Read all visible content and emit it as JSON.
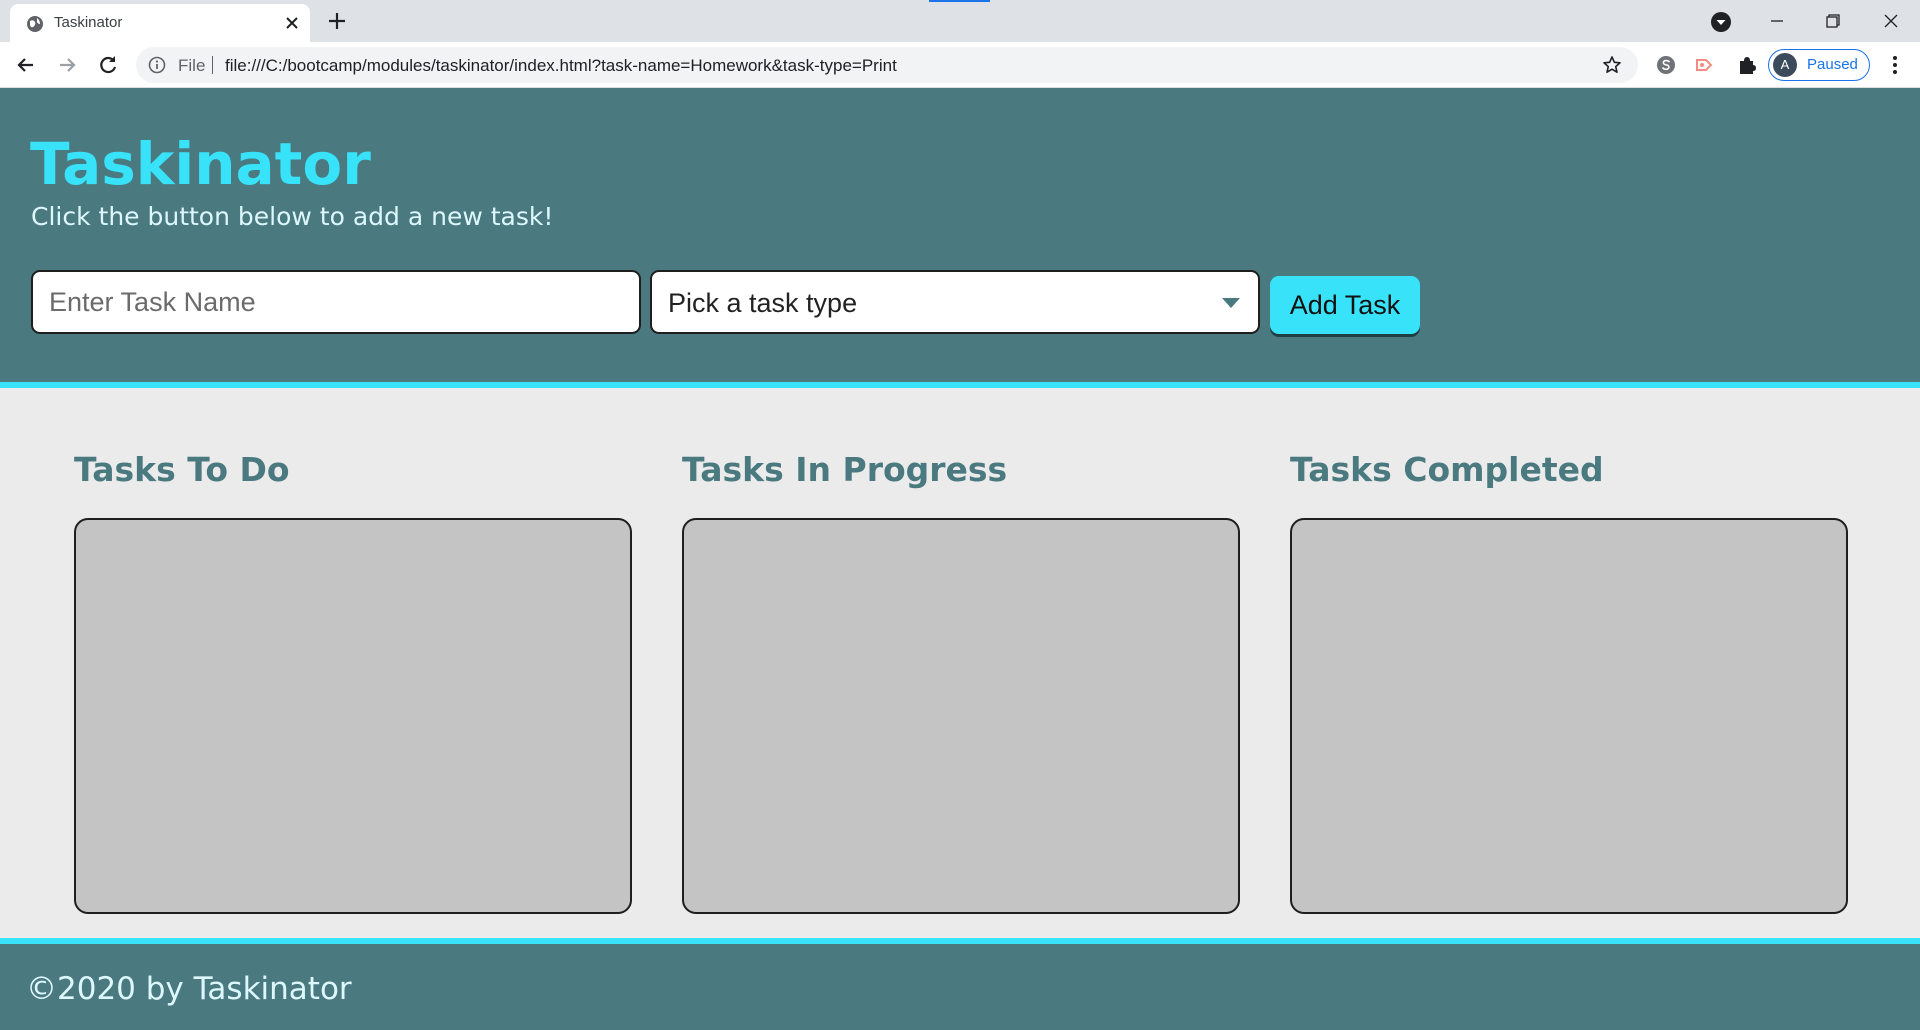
{
  "browser": {
    "tab_title": "Taskinator",
    "omnibox": {
      "file_label": "File",
      "url": "file:///C:/bootcamp/modules/taskinator/index.html?task-name=Homework&task-type=Print"
    },
    "profile": {
      "initial": "A",
      "status": "Paused"
    },
    "icons": [
      "globe-icon",
      "close-icon",
      "plus-icon",
      "back-icon",
      "forward-icon",
      "reload-icon",
      "info-icon",
      "star-icon",
      "skype-icon",
      "cast-icon",
      "puzzle-icon",
      "kebab-menu-icon",
      "minimize-icon",
      "restore-icon"
    ]
  },
  "header": {
    "title": "Taskinator",
    "subtitle": "Click the button below to add a new task!"
  },
  "form": {
    "task_name_placeholder": "Enter Task Name",
    "task_name_value": "",
    "task_type_selected": "Pick a task type",
    "submit_label": "Add Task"
  },
  "columns": [
    {
      "title": "Tasks To Do",
      "tasks": []
    },
    {
      "title": "Tasks In Progress",
      "tasks": []
    },
    {
      "title": "Tasks Completed",
      "tasks": []
    }
  ],
  "footer": {
    "text": "©2020 by Taskinator"
  },
  "colors": {
    "header_bg": "#4a7980",
    "accent": "#38e2f9",
    "page_bg": "#ebebeb",
    "list_bg": "#c4c4c4",
    "subtitle_text": "#ddf8fc"
  }
}
